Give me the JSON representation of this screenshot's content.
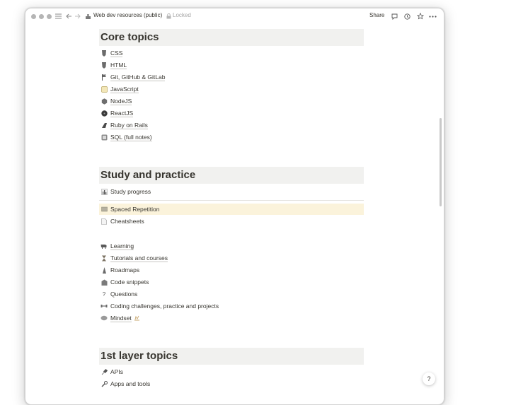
{
  "window": {
    "breadcrumb": "Web dev resources (public)",
    "locked_label": "Locked",
    "share_label": "Share"
  },
  "sections": {
    "core": {
      "title": "Core topics",
      "items": [
        "CSS",
        "HTML",
        "Git, GitHub & GitLab",
        "JavaScript",
        "NodeJS",
        "ReactJS",
        "Ruby on Rails",
        "SQL (full notes)"
      ]
    },
    "study": {
      "title": "Study and practice",
      "progress": "Study progress",
      "spaced": "Spaced Repetition",
      "cheatsheets": "Cheatsheets",
      "items": [
        "Learning",
        "Tutorials and courses",
        "Roadmaps",
        "Code snippets",
        "Questions",
        "Coding challenges, practice and projects",
        "Mindset"
      ]
    },
    "first_layer": {
      "title": "1st layer topics",
      "items": [
        "APIs",
        "Apps and tools"
      ]
    }
  },
  "help_label": "?",
  "colors": {
    "heading_bg": "#f1f1ef",
    "highlight_bg": "#fbf3db",
    "text": "#37352f"
  }
}
